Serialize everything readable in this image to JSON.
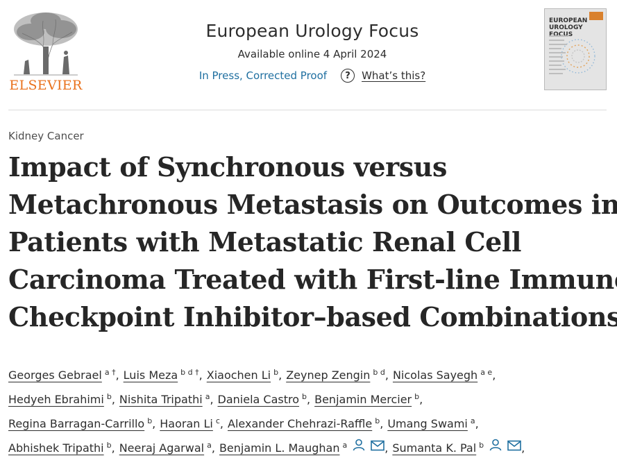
{
  "publisher": {
    "name": "ELSEVIER"
  },
  "journal": {
    "title": "European Urology Focus",
    "available_online": "Available online 4 April 2024",
    "status_link": "In Press, Corrected Proof",
    "help_link": "What’s this?",
    "help_icon": "question-circle-icon",
    "cover_title_line1": "EUROPEAN",
    "cover_title_line2": "UROLOGY FOCUS"
  },
  "article": {
    "section": "Kidney Cancer",
    "title_lines": [
      "Impact of Synchronous versus",
      "Metachronous Metastasis on Outcomes in",
      "Patients with Metastatic Renal Cell",
      "Carcinoma Treated with First-line Immune",
      "Checkpoint Inhibitor–based Combinations"
    ]
  },
  "authors": [
    [
      {
        "name": "Georges Gebrael",
        "aff": "a †"
      },
      {
        "name": "Luis Meza",
        "aff": "b d †"
      },
      {
        "name": "Xiaochen Li",
        "aff": "b"
      },
      {
        "name": "Zeynep Zengin",
        "aff": "b d"
      },
      {
        "name": "Nicolas Sayegh",
        "aff": "a e"
      }
    ],
    [
      {
        "name": "Hedyeh Ebrahimi",
        "aff": "b"
      },
      {
        "name": "Nishita Tripathi",
        "aff": "a"
      },
      {
        "name": "Daniela Castro",
        "aff": "b"
      },
      {
        "name": "Benjamin Mercier",
        "aff": "b"
      }
    ],
    [
      {
        "name": "Regina Barragan-Carrillo",
        "aff": "b"
      },
      {
        "name": "Haoran Li",
        "aff": "c"
      },
      {
        "name": "Alexander Chehrazi-Raffle",
        "aff": "b"
      },
      {
        "name": "Umang Swami",
        "aff": "a"
      }
    ],
    [
      {
        "name": "Abhishek Tripathi",
        "aff": "b"
      },
      {
        "name": "Neeraj Agarwal",
        "aff": "a"
      },
      {
        "name": "Benjamin L. Maughan",
        "aff": "a",
        "icons": [
          "person-icon",
          "envelope-icon"
        ]
      },
      {
        "name": "Sumanta K. Pal",
        "aff": "b",
        "icons": [
          "person-icon",
          "envelope-icon"
        ]
      }
    ]
  ],
  "colors": {
    "link": "#1f6fa0",
    "publisher": "#e9711c",
    "text": "#2e2e2e"
  }
}
